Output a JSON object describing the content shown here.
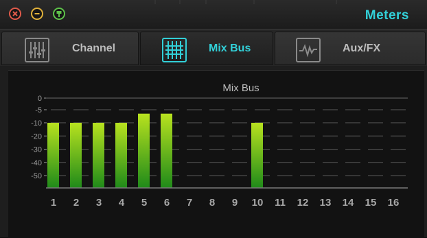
{
  "window": {
    "title": "Meters",
    "buttons": [
      {
        "name": "close",
        "color": "#e05a4a"
      },
      {
        "name": "minimize",
        "color": "#e0b13a"
      },
      {
        "name": "pin",
        "color": "#5ec24a"
      }
    ]
  },
  "tabs": [
    {
      "label": "Channel",
      "icon": "faders-icon",
      "active": false
    },
    {
      "label": "Mix Bus",
      "icon": "mix-bus-grid-icon",
      "active": true
    },
    {
      "label": "Aux/FX",
      "icon": "waveform-icon",
      "active": false
    }
  ],
  "colors": {
    "accent": "#32d0d8",
    "bar_top": "#b8e21f",
    "bar_bottom": "#1f8a1a",
    "text": "#bdbdbd"
  },
  "chart_data": {
    "type": "bar",
    "title": "Mix Bus",
    "categories": [
      "1",
      "2",
      "3",
      "4",
      "5",
      "6",
      "7",
      "8",
      "9",
      "10",
      "11",
      "12",
      "13",
      "14",
      "15",
      "16"
    ],
    "values": [
      -10,
      -10,
      -10,
      -10,
      -6.5,
      -6.5,
      null,
      null,
      null,
      -10,
      null,
      null,
      null,
      null,
      null,
      null
    ],
    "ylim": [
      -60,
      0
    ],
    "yticks": [
      0,
      -5,
      -10,
      -20,
      -30,
      -40,
      -50
    ],
    "ytick_labels": [
      "0",
      "-5",
      "-10",
      "-20",
      "-30",
      "-40",
      "-50"
    ],
    "grid": true
  }
}
